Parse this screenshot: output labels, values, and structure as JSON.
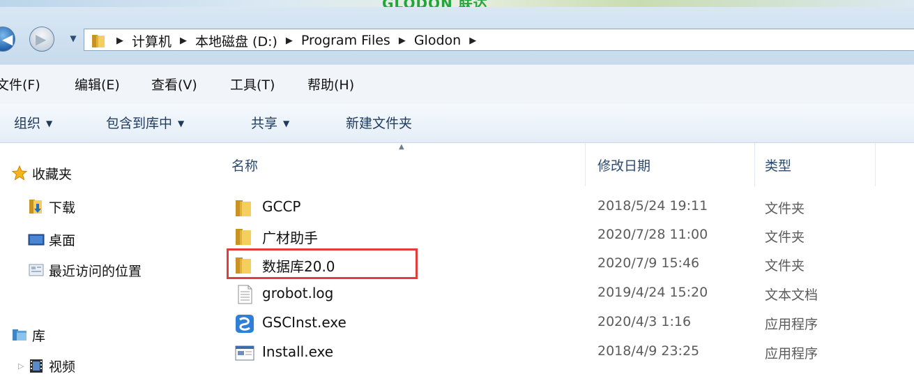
{
  "window": {
    "title_logo": "GLODON 联达"
  },
  "address": {
    "breadcrumbs": [
      "计算机",
      "本地磁盘 (D:)",
      "Program Files",
      "Glodon"
    ]
  },
  "menu": {
    "items": [
      "文件(F)",
      "编辑(E)",
      "查看(V)",
      "工具(T)",
      "帮助(H)"
    ]
  },
  "commands": {
    "organize": "组织",
    "include_in_library": "包含到库中",
    "share": "共享",
    "new_folder": "新建文件夹"
  },
  "nav": {
    "favorites": "收藏夹",
    "downloads": "下载",
    "desktop": "桌面",
    "recent_places": "最近访问的位置",
    "libraries": "库",
    "videos": "视频"
  },
  "columns": {
    "name": "名称",
    "date_modified": "修改日期",
    "type": "类型"
  },
  "files": [
    {
      "name": "GCCP",
      "date": "2018/5/24 19:11",
      "type": "文件夹",
      "icon": "folder-icon"
    },
    {
      "name": "广材助手",
      "date": "2020/7/28 11:00",
      "type": "文件夹",
      "icon": "folder-icon"
    },
    {
      "name": "数据库20.0",
      "date": "2020/7/9 15:46",
      "type": "文件夹",
      "icon": "folder-icon"
    },
    {
      "name": "grobot.log",
      "date": "2019/4/24 15:20",
      "type": "文本文档",
      "icon": "text-file-icon"
    },
    {
      "name": "GSCInst.exe",
      "date": "2020/4/3 1:16",
      "type": "应用程序",
      "icon": "app-icon"
    },
    {
      "name": "Install.exe",
      "date": "2018/4/9 23:25",
      "type": "应用程序",
      "icon": "exe-window-icon"
    }
  ],
  "highlight": {
    "color": "#e43b3b",
    "file_index": 2
  }
}
